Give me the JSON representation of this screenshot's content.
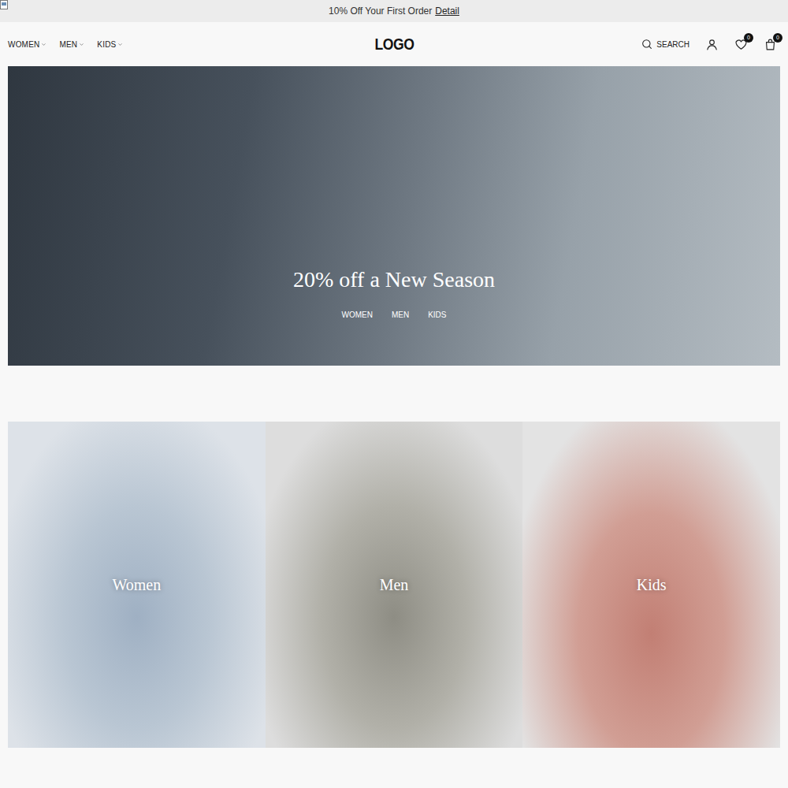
{
  "announcement": {
    "text": "10% Off Your First Order",
    "link": "Detail"
  },
  "nav": {
    "items": [
      {
        "label": "WOMEN"
      },
      {
        "label": "MEN"
      },
      {
        "label": "KIDS"
      }
    ]
  },
  "logo": "LOGO",
  "actions": {
    "search": "SEARCH",
    "wishlist_count": "0",
    "cart_count": "0"
  },
  "hero": {
    "title": "20% off a New Season",
    "links": [
      "WOMEN",
      "MEN",
      "KIDS"
    ]
  },
  "categories": [
    {
      "label": "Women"
    },
    {
      "label": "Men"
    },
    {
      "label": "Kids"
    }
  ]
}
